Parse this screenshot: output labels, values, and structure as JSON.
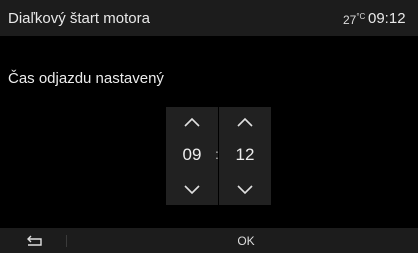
{
  "header": {
    "title": "Diaľkový štart motora",
    "temperature": "27",
    "temperature_unit": "°C",
    "clock": "09:12"
  },
  "message": "Čas odjazdu nastavený",
  "time_picker": {
    "hours": "09",
    "separator": ":",
    "minutes": "12"
  },
  "footer": {
    "ok_label": "OK",
    "back_icon": "back-arrow-icon"
  },
  "colors": {
    "background": "#000000",
    "bar": "#1c1c1c",
    "picker_column": "#212121",
    "text": "#e6e6e6"
  }
}
